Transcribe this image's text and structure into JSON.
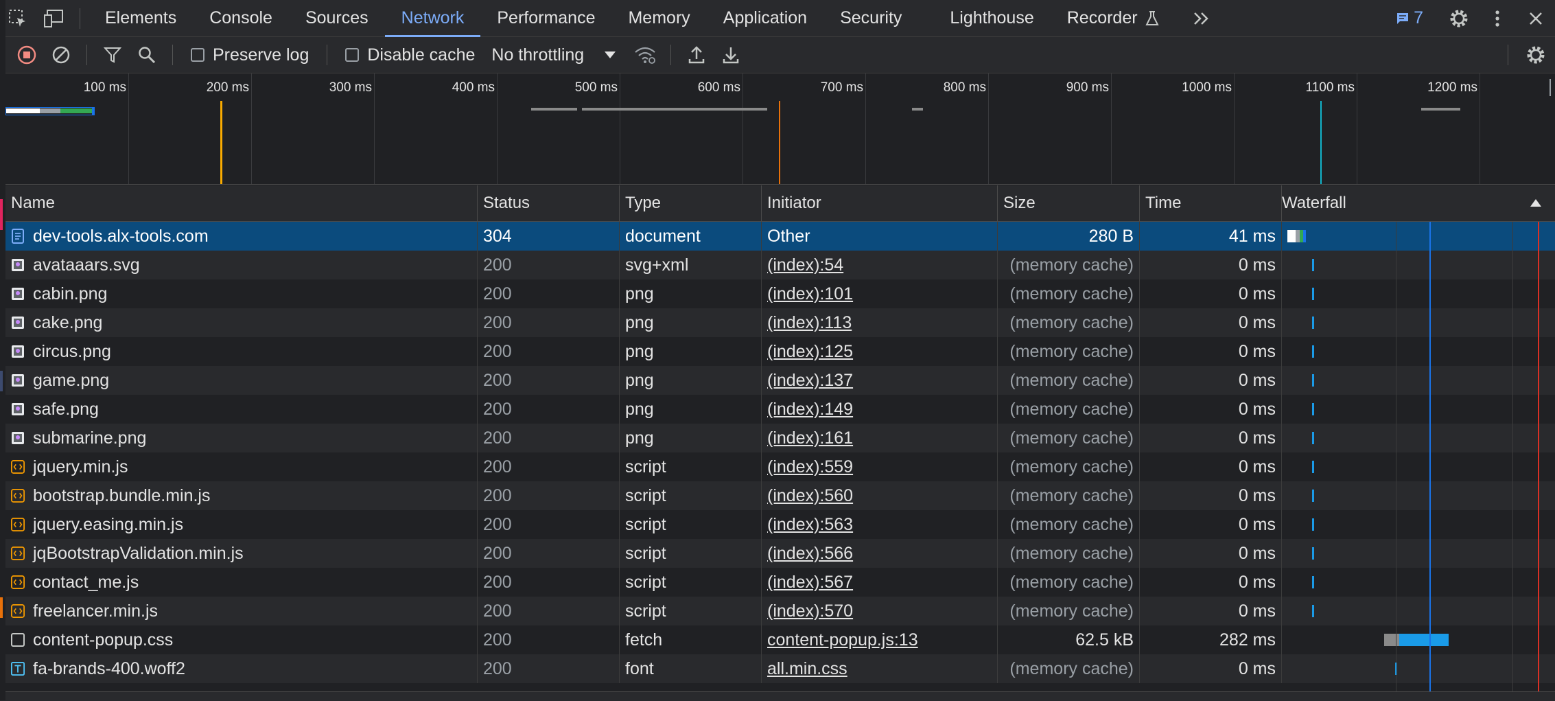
{
  "tabs": [
    "Elements",
    "Console",
    "Sources",
    "Network",
    "Performance",
    "Memory",
    "Application",
    "Security",
    "Lighthouse",
    "Recorder"
  ],
  "active_tab": "Network",
  "message_count": "7",
  "toolbar": {
    "preserve_log": "Preserve log",
    "disable_cache": "Disable cache",
    "throttling": "No throttling"
  },
  "overview": {
    "ticks": [
      "100 ms",
      "200 ms",
      "300 ms",
      "400 ms",
      "500 ms",
      "600 ms",
      "700 ms",
      "800 ms",
      "900 ms",
      "1000 ms",
      "1100 ms",
      "1200 ms"
    ],
    "dom_content_loaded_color": "#f9ab00",
    "load_color": "#e8710a",
    "other_marker_color": "#12b5cb"
  },
  "table": {
    "columns": [
      "Name",
      "Status",
      "Type",
      "Initiator",
      "Size",
      "Time",
      "Waterfall"
    ],
    "rows": [
      {
        "name": "dev-tools.alx-tools.com",
        "status": "304",
        "type": "document",
        "initiator": "Other",
        "size": "280 B",
        "time": "41 ms",
        "icon": "document-icon",
        "selected": true
      },
      {
        "name": "avataaars.svg",
        "status": "200",
        "type": "svg+xml",
        "initiator": "(index):54",
        "size": "(memory cache)",
        "time": "0 ms",
        "icon": "image-icon"
      },
      {
        "name": "cabin.png",
        "status": "200",
        "type": "png",
        "initiator": "(index):101",
        "size": "(memory cache)",
        "time": "0 ms",
        "icon": "image-icon"
      },
      {
        "name": "cake.png",
        "status": "200",
        "type": "png",
        "initiator": "(index):113",
        "size": "(memory cache)",
        "time": "0 ms",
        "icon": "image-icon"
      },
      {
        "name": "circus.png",
        "status": "200",
        "type": "png",
        "initiator": "(index):125",
        "size": "(memory cache)",
        "time": "0 ms",
        "icon": "image-icon"
      },
      {
        "name": "game.png",
        "status": "200",
        "type": "png",
        "initiator": "(index):137",
        "size": "(memory cache)",
        "time": "0 ms",
        "icon": "image-icon"
      },
      {
        "name": "safe.png",
        "status": "200",
        "type": "png",
        "initiator": "(index):149",
        "size": "(memory cache)",
        "time": "0 ms",
        "icon": "image-icon"
      },
      {
        "name": "submarine.png",
        "status": "200",
        "type": "png",
        "initiator": "(index):161",
        "size": "(memory cache)",
        "time": "0 ms",
        "icon": "image-icon"
      },
      {
        "name": "jquery.min.js",
        "status": "200",
        "type": "script",
        "initiator": "(index):559",
        "size": "(memory cache)",
        "time": "0 ms",
        "icon": "script-icon"
      },
      {
        "name": "bootstrap.bundle.min.js",
        "status": "200",
        "type": "script",
        "initiator": "(index):560",
        "size": "(memory cache)",
        "time": "0 ms",
        "icon": "script-icon"
      },
      {
        "name": "jquery.easing.min.js",
        "status": "200",
        "type": "script",
        "initiator": "(index):563",
        "size": "(memory cache)",
        "time": "0 ms",
        "icon": "script-icon"
      },
      {
        "name": "jqBootstrapValidation.min.js",
        "status": "200",
        "type": "script",
        "initiator": "(index):566",
        "size": "(memory cache)",
        "time": "0 ms",
        "icon": "script-icon"
      },
      {
        "name": "contact_me.js",
        "status": "200",
        "type": "script",
        "initiator": "(index):567",
        "size": "(memory cache)",
        "time": "0 ms",
        "icon": "script-icon"
      },
      {
        "name": "freelancer.min.js",
        "status": "200",
        "type": "script",
        "initiator": "(index):570",
        "size": "(memory cache)",
        "time": "0 ms",
        "icon": "script-icon"
      },
      {
        "name": "content-popup.css",
        "status": "200",
        "type": "fetch",
        "initiator": "content-popup.js:13",
        "size": "62.5 kB",
        "time": "282 ms",
        "icon": "fetch-icon"
      },
      {
        "name": "fa-brands-400.woff2",
        "status": "200",
        "type": "font",
        "initiator": "all.min.css",
        "size": "(memory cache)",
        "time": "0 ms",
        "icon": "font-icon"
      }
    ]
  }
}
